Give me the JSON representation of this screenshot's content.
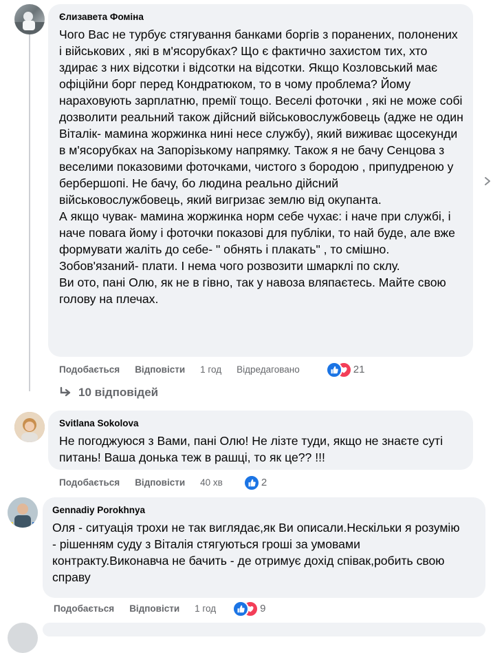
{
  "comments": [
    {
      "author": "Єлизавета Фоміна",
      "paragraphs": [
        "Чого Вас не турбує стягування банками боргів з поранених, полонених і військових , які в м'ясорубках? Що є фактично захистом тих, хто здирає з них відсотки і відсотки на відсотки. Якщо Козловський має офіційни борг перед Кондратюком, то в чому проблема? Йому нараховують зарплатню, премії тощо. Веселі фоточки , які не може собі дозволити реальний також дійсний військовослужбовець (адже не один Віталік- мамина жоржинка нині несе службу), який виживає щосекунди в м'ясорубках на Запорізькому напрямку. Також я не бачу Сенцова з веселими показовими фоточками, чистого з бородою , припудреною у бербершопі. Не бачу, бо людина реально дійсний військовослужбовець, який вигризає землю від окупанта.",
        "А якщо чувак- мамина жоржинка норм себе чухає: і наче при службі, і наче повага йому і фоточки показові для публіки, то най буде, але вже формувати жаліть до себе- \" обнять і плакать\" , то смішно. Зобов'язаний- плати. І нема чого розвозити шмарклі по склу.",
        "Ви ото, пані Олю, як не в гівно, так у навоза вляпаєтесь. Майте свою голову на плечах."
      ],
      "like_label": "Подобається",
      "reply_label": "Відповісти",
      "time": "1 год",
      "edited": "Відредаговано",
      "reaction_count": "21",
      "replies_label": "10 відповідей"
    },
    {
      "author": "Svitlana Sokolova",
      "paragraphs": [
        "Не погоджуюся з Вами, пані Олю! Не лізте туди, якщо не знаєте суті питань! Ваша донька теж в рашці, то як це?? !!!"
      ],
      "like_label": "Подобається",
      "reply_label": "Відповісти",
      "time": "40 хв",
      "reaction_count": "2"
    },
    {
      "author": "Gennadiy Porokhnya",
      "paragraphs": [
        "Оля - ситуація трохи не так виглядає,як Ви описали.Нескільки я розумію - рішенням суду з Віталія стягуються гроші за умовами контракту.Виконавча не бачить - де отримує дохід співак,робить свою справу"
      ],
      "like_label": "Подобається",
      "reply_label": "Відповісти",
      "time": "1 год",
      "reaction_count": "9"
    }
  ],
  "colors": {
    "bubble": "#f0f2f5",
    "like_blue": "#1b74e4",
    "love_red": "#f33e58",
    "secondary_text": "#65676b"
  },
  "icons": {
    "like": "thumbs-up-icon",
    "love": "heart-icon",
    "reply_arrow": "reply-arrow-icon",
    "scroll": "chevron-right-icon"
  }
}
